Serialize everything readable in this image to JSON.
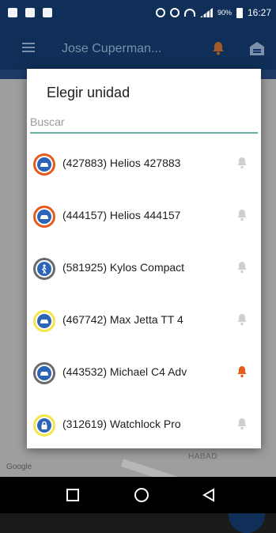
{
  "status_bar": {
    "battery": "90%",
    "time": "16:27"
  },
  "app_bar": {
    "title": "Jose Cuperman..."
  },
  "dialog": {
    "title": "Elegir unidad",
    "search_placeholder": "Buscar",
    "units": [
      {
        "label": "(427883) Helios 427883",
        "ring_color": "#e85a1b",
        "icon": "car-icon",
        "bell_active": false
      },
      {
        "label": "(444157) Helios 444157",
        "ring_color": "#e85a1b",
        "icon": "car-icon",
        "bell_active": false
      },
      {
        "label": "(581925) Kylos Compact",
        "ring_color": "#6b6b6b",
        "icon": "walker-icon",
        "bell_active": false
      },
      {
        "label": "(467742) Max Jetta TT 4",
        "ring_color": "#f3e64a",
        "icon": "car-icon",
        "bell_active": false
      },
      {
        "label": "(443532) Michael C4 Adv",
        "ring_color": "#6b6b6b",
        "icon": "car-icon",
        "bell_active": true
      },
      {
        "label": "(312619) Watchlock Pro",
        "ring_color": "#f3e64a",
        "icon": "lock-icon",
        "bell_active": false
      }
    ]
  },
  "map": {
    "attribution": "Google",
    "street_fragment": "HABAD"
  },
  "colors": {
    "primary": "#0f2f58",
    "accent_orange": "#e85a1b",
    "bell_inactive": "#cfcfcf",
    "search_underline": "#6aaea8"
  }
}
